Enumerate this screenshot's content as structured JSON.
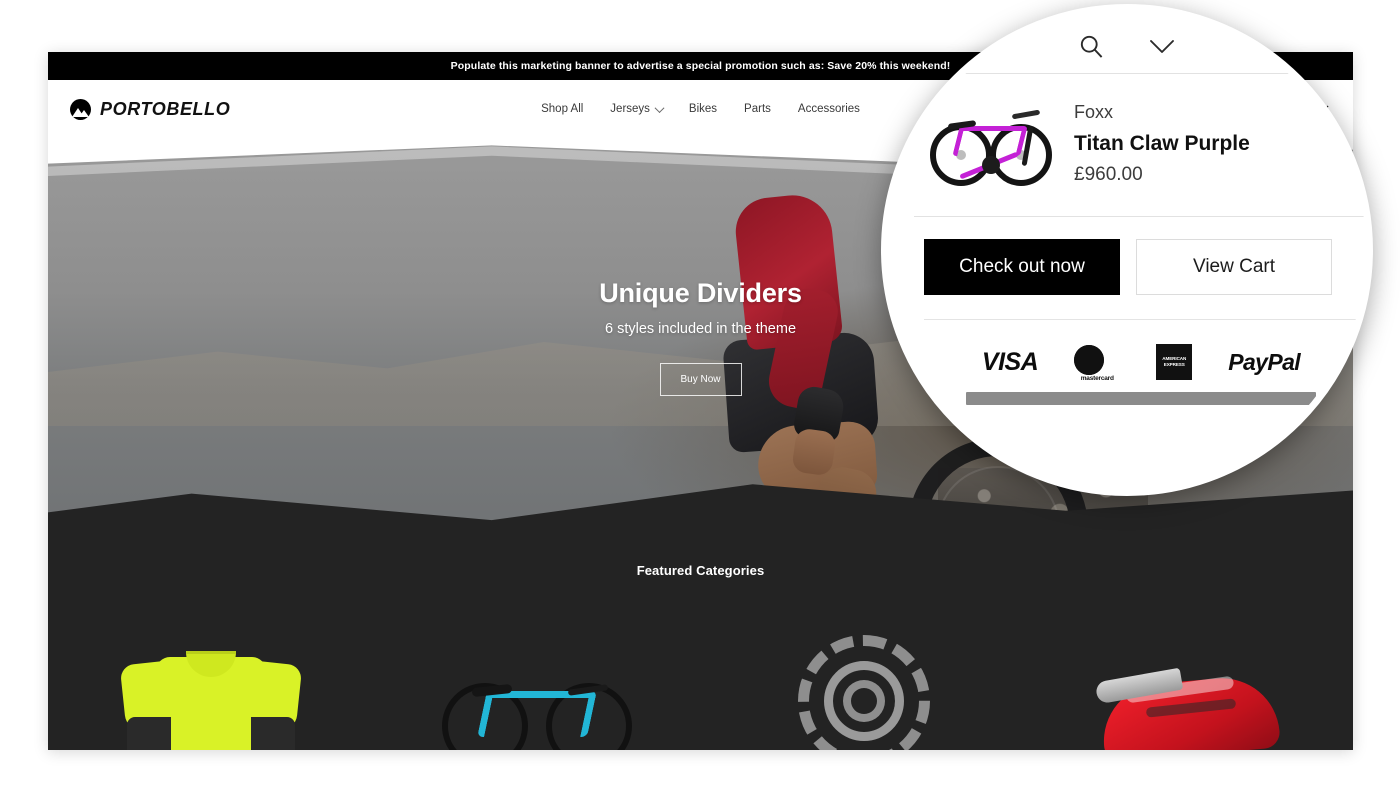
{
  "promo": {
    "text": "Populate this marketing banner to advertise a special promotion such as: Save 20% this weekend!"
  },
  "header": {
    "logo_text": "PORTOBELLO",
    "logo_icon": "mountain-circle-icon",
    "nav": [
      {
        "label": "Shop All",
        "has_caret": false
      },
      {
        "label": "Jerseys",
        "has_caret": true
      },
      {
        "label": "Bikes",
        "has_caret": false
      },
      {
        "label": "Parts",
        "has_caret": false
      },
      {
        "label": "Accessories",
        "has_caret": false
      }
    ],
    "icons": [
      {
        "name": "search-icon"
      },
      {
        "name": "chevron-down-icon"
      }
    ]
  },
  "hero": {
    "heading": "Unique Dividers",
    "subheading": "6 styles included in the theme",
    "cta_label": "Buy Now",
    "slides": 3,
    "active_slide": 1
  },
  "featured": {
    "title": "Featured Categories",
    "items": [
      {
        "name": "jersey-category"
      },
      {
        "name": "bike-category"
      },
      {
        "name": "rotor-category"
      },
      {
        "name": "helmet-category"
      }
    ]
  },
  "magnifier": {
    "icons": [
      {
        "name": "search-icon",
        "label": "Search"
      },
      {
        "name": "chevron-down-icon",
        "label": "Cart dropdown"
      }
    ],
    "cart": {
      "item": {
        "vendor": "Foxx",
        "title": "Titan Claw Purple",
        "price": "£960.00",
        "thumbnail": "purple-mountain-bike-image"
      },
      "checkout_label": "Check out now",
      "view_cart_label": "View Cart",
      "payment_methods": [
        {
          "name": "visa-logo",
          "label": "VISA"
        },
        {
          "name": "mastercard-logo",
          "label": "mastercard"
        },
        {
          "name": "amex-logo",
          "line1": "AMERICAN",
          "line2": "EXPRESS"
        },
        {
          "name": "paypal-logo",
          "label": "PayPal"
        }
      ]
    }
  },
  "colors": {
    "accent_black": "#000000",
    "dark_section": "#232323",
    "bike_purple": "#c421d6",
    "jersey_yellow": "#d9f227",
    "helmet_red": "#d4141f",
    "bike_blue": "#22b6d6"
  }
}
